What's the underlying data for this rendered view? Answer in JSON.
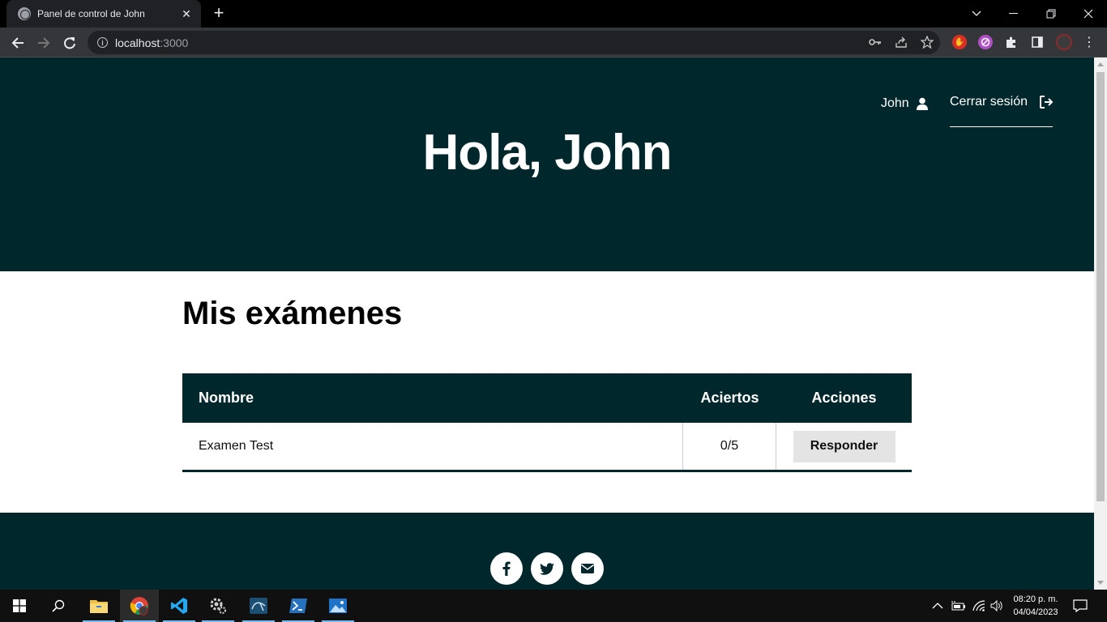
{
  "browser": {
    "tab_title": "Panel de control de John",
    "tab_close": "✕",
    "new_tab": "+",
    "url_host": "localhost",
    "url_port": ":3000"
  },
  "header": {
    "username": "John",
    "logout_label": "Cerrar sesión",
    "greeting": "Hola, John"
  },
  "main": {
    "section_title": "Mis exámenes",
    "table": {
      "columns": [
        "Nombre",
        "Aciertos",
        "Acciones"
      ],
      "rows": [
        {
          "name": "Examen Test",
          "score": "0/5",
          "action": "Responder"
        }
      ]
    }
  },
  "footer": {
    "social": [
      "facebook-icon",
      "twitter-icon",
      "envelope-icon"
    ]
  },
  "taskbar": {
    "time": "08:20 p. m.",
    "date": "04/04/2023"
  },
  "colors": {
    "primary": "#00272b",
    "button_bg": "#e4e4e4"
  }
}
